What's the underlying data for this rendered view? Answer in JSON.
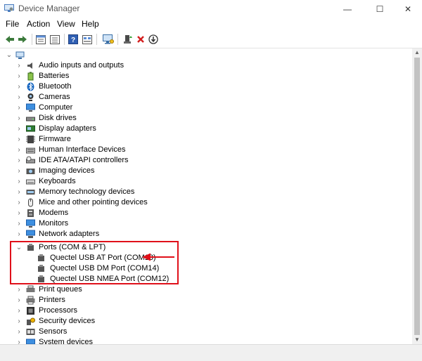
{
  "window": {
    "title": "Device Manager",
    "minimize_glyph": "—",
    "maximize_glyph": "☐",
    "close_glyph": "✕"
  },
  "menu": [
    "File",
    "Action",
    "View",
    "Help"
  ],
  "toolbar_icons": [
    "back-arrow-icon",
    "forward-arrow-icon",
    "properties-icon",
    "show-hidden-icon",
    "help-icon",
    "view-icon",
    "scan-hardware-icon",
    "update-driver-icon",
    "uninstall-icon",
    "disable-icon"
  ],
  "tree": {
    "root_label": "",
    "categories": [
      {
        "label": "Audio inputs and outputs",
        "icon": "speaker-icon"
      },
      {
        "label": "Batteries",
        "icon": "battery-icon"
      },
      {
        "label": "Bluetooth",
        "icon": "bluetooth-icon"
      },
      {
        "label": "Cameras",
        "icon": "camera-icon"
      },
      {
        "label": "Computer",
        "icon": "computer-icon"
      },
      {
        "label": "Disk drives",
        "icon": "disk-drive-icon"
      },
      {
        "label": "Display adapters",
        "icon": "display-adapter-icon"
      },
      {
        "label": "Firmware",
        "icon": "firmware-icon"
      },
      {
        "label": "Human Interface Devices",
        "icon": "hid-icon"
      },
      {
        "label": "IDE ATA/ATAPI controllers",
        "icon": "ide-controller-icon"
      },
      {
        "label": "Imaging devices",
        "icon": "imaging-device-icon"
      },
      {
        "label": "Keyboards",
        "icon": "keyboard-icon"
      },
      {
        "label": "Memory technology devices",
        "icon": "memory-device-icon"
      },
      {
        "label": "Mice and other pointing devices",
        "icon": "mouse-icon"
      },
      {
        "label": "Modems",
        "icon": "modem-icon"
      },
      {
        "label": "Monitors",
        "icon": "monitor-icon"
      },
      {
        "label": "Network adapters",
        "icon": "network-adapter-icon"
      }
    ],
    "ports": {
      "label": "Ports (COM & LPT)",
      "children": [
        "Quectel USB AT Port (COM13)",
        "Quectel USB DM Port (COM14)",
        "Quectel USB NMEA Port (COM12)"
      ]
    },
    "categories_after": [
      {
        "label": "Print queues",
        "icon": "print-queue-icon"
      },
      {
        "label": "Printers",
        "icon": "printer-icon"
      },
      {
        "label": "Processors",
        "icon": "processor-icon"
      },
      {
        "label": "Security devices",
        "icon": "security-device-icon"
      },
      {
        "label": "Sensors",
        "icon": "sensor-icon"
      },
      {
        "label": "System devices",
        "icon": "system-device-icon"
      }
    ]
  },
  "glyphs": {
    "collapsed": "›",
    "expanded": "⌄"
  },
  "colors": {
    "highlight_red": "#e0101a"
  }
}
